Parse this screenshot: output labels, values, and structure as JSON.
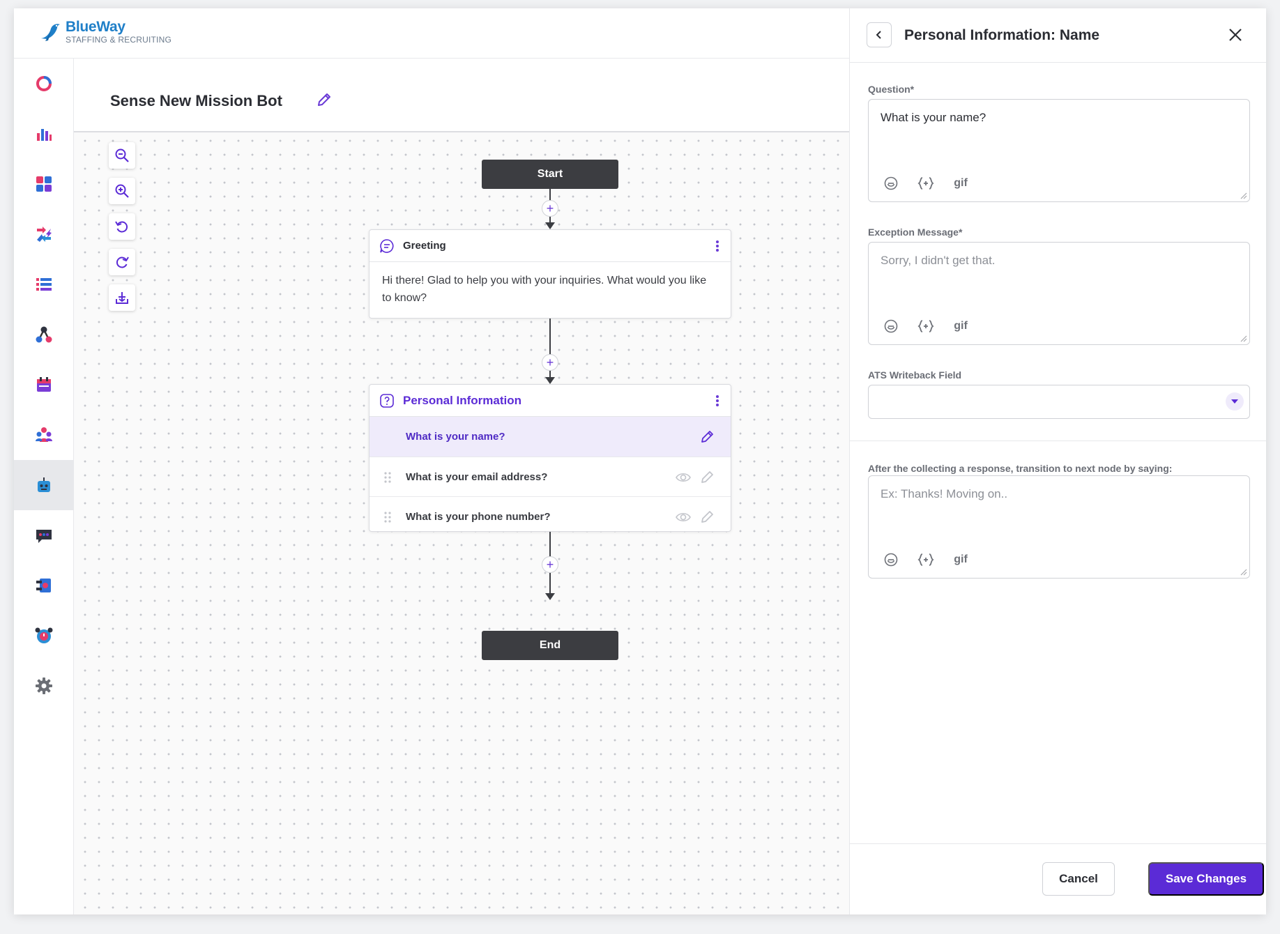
{
  "brand": {
    "name": "BlueWay",
    "tagline": "STAFFING & RECRUITING",
    "accent": "#1f7fc8"
  },
  "bot": {
    "title": "Sense New Mission Bot"
  },
  "colors": {
    "primary": "#5b2bd6",
    "terminal": "#3c3d41"
  },
  "sidebar": {
    "items": [
      {
        "name": "ring-icon"
      },
      {
        "name": "bar-chart-icon"
      },
      {
        "name": "dashboard-grid-icon"
      },
      {
        "name": "shuffle-icon"
      },
      {
        "name": "list-icon"
      },
      {
        "name": "network-icon"
      },
      {
        "name": "calendar-icon"
      },
      {
        "name": "team-icon"
      },
      {
        "name": "bot-icon",
        "active": true
      },
      {
        "name": "chat-icon"
      },
      {
        "name": "journey-icon"
      },
      {
        "name": "alarm-icon"
      },
      {
        "name": "gear-icon"
      }
    ]
  },
  "tools": [
    "zoom-out-icon",
    "zoom-in-icon",
    "undo-icon",
    "redo-icon",
    "download-icon"
  ],
  "flow": {
    "start_label": "Start",
    "end_label": "End",
    "greeting": {
      "title": "Greeting",
      "message": "Hi there! Glad to help you with your inquiries. What would you like to know?"
    },
    "personal_info": {
      "title": "Personal Information",
      "questions": [
        {
          "text": "What is your name?",
          "active": true
        },
        {
          "text": "What is your email address?"
        },
        {
          "text": "What is your phone number?"
        }
      ]
    }
  },
  "panel": {
    "title": "Personal Information: Name",
    "question_label": "Question*",
    "question_value": "What is your name?",
    "exception_label": "Exception Message*",
    "exception_placeholder": "Sorry, I didn't get that.",
    "ats_label": "ATS Writeback Field",
    "ats_value": "",
    "transition_label": "After the collecting a response, transition to next node by saying:",
    "transition_placeholder": "Ex: Thanks! Moving on..",
    "gif_label": "gif",
    "cancel_label": "Cancel",
    "save_label": "Save Changes"
  }
}
